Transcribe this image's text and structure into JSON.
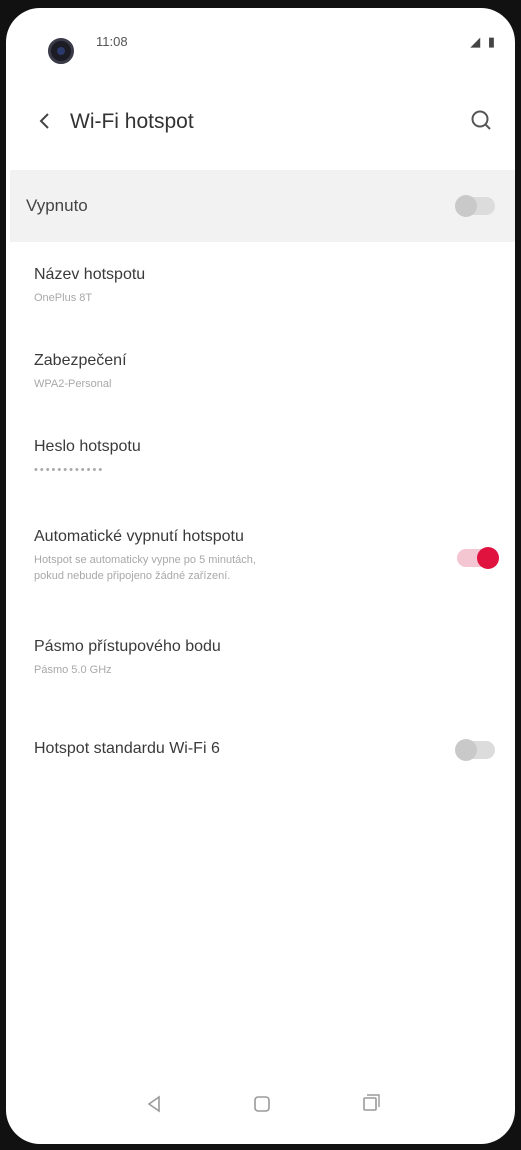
{
  "status_bar": {
    "time": "11:08",
    "icons": "◢ ▮"
  },
  "header": {
    "title": "Wi-Fi hotspot"
  },
  "master": {
    "label": "Vypnuto",
    "enabled": false
  },
  "settings": [
    {
      "title": "Název hotspotu",
      "value": "OnePlus 8T"
    },
    {
      "title": "Zabezpečení",
      "value": "WPA2-Personal"
    },
    {
      "title": "Heslo hotspotu",
      "value": "••••••••••••"
    },
    {
      "title": "Automatické vypnutí hotspotu",
      "value": "Hotspot se automaticky vypne po 5 minutách,",
      "value2": "pokud nebude připojeno žádné zařízení.",
      "enabled": true
    },
    {
      "title": "Pásmo přístupového bodu",
      "value": "Pásmo 5.0 GHz"
    },
    {
      "title": "Hotspot standardu Wi-Fi 6",
      "enabled": false
    }
  ],
  "icons": {
    "back": "chevron-left-icon",
    "search": "search-icon",
    "nav_back": "triangle-back-icon",
    "nav_home": "home-icon",
    "nav_recents": "recents-icon"
  },
  "colors": {
    "accent": "#e0123e",
    "toggle_track_on": "#f4c6d2",
    "toggle_off": "#dcdcdc"
  }
}
